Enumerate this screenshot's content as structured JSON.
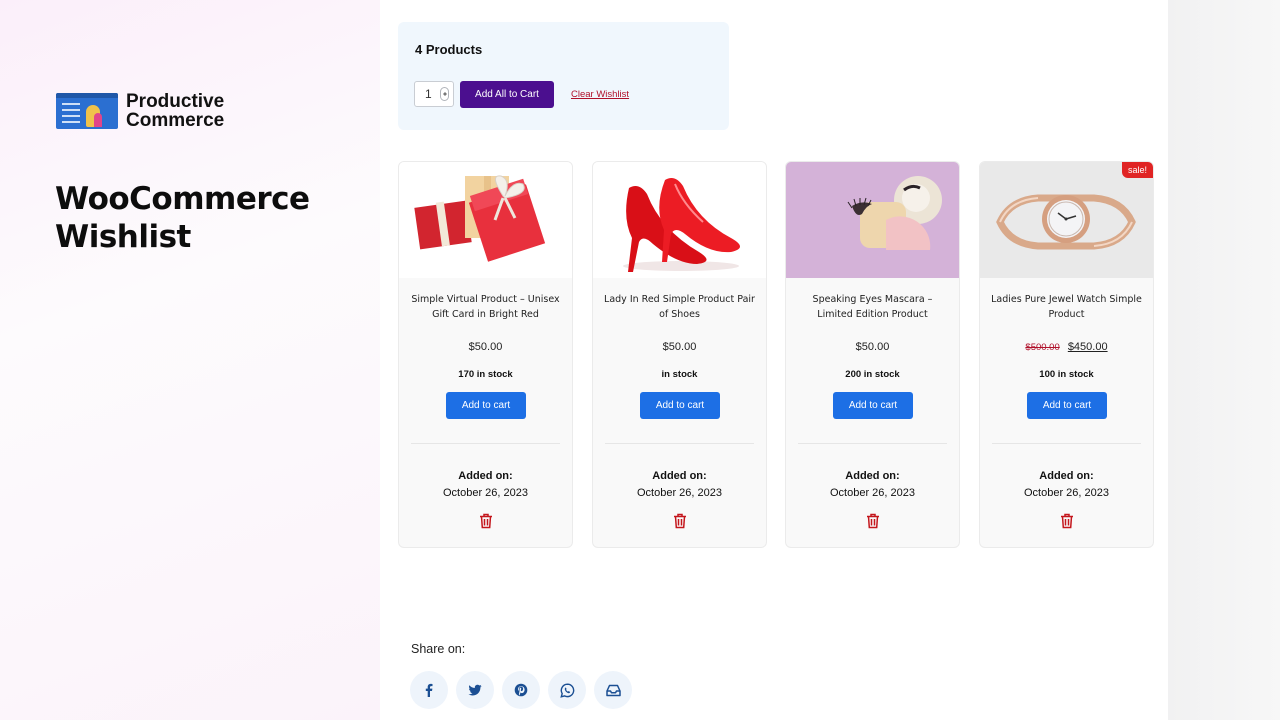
{
  "promo": {
    "brand_line1": "Productive",
    "brand_line2": "Commerce",
    "title_line1": "WooCommerce",
    "title_line2": "Wishlist"
  },
  "wishlist": {
    "count_label": "4 Products",
    "quantity": "1",
    "add_all_label": "Add All to Cart",
    "clear_label": "Clear Wishlist"
  },
  "products": [
    {
      "name": "Simple Virtual Product – Unisex Gift Card in Bright Red",
      "old_price": "",
      "price": "$50.00",
      "stock": "170 in stock",
      "cart_label": "Add to cart",
      "added_label": "Added on:",
      "added_date": "October 26, 2023",
      "image": "gift-box-image"
    },
    {
      "name": "Lady In Red Simple Product Pair of Shoes",
      "old_price": "",
      "price": "$50.00",
      "stock": "in stock",
      "cart_label": "Add to cart",
      "added_label": "Added on:",
      "added_date": "October 26, 2023",
      "image": "red-heels-image"
    },
    {
      "name": "Speaking Eyes Mascara – Limited Edition Product",
      "old_price": "",
      "price": "$50.00",
      "stock": "200 in stock",
      "cart_label": "Add to cart",
      "added_label": "Added on:",
      "added_date": "October 26, 2023",
      "image": "eyelash-image"
    },
    {
      "name": "Ladies Pure Jewel Watch Simple Product",
      "old_price": "$500.00",
      "price": "$450.00",
      "stock": "100 in stock",
      "cart_label": "Add to cart",
      "added_label": "Added on:",
      "added_date": "October 26, 2023",
      "image": "watch-image",
      "badge": "sale!"
    }
  ],
  "share": {
    "label": "Share on:",
    "icons": [
      "facebook-icon",
      "twitter-icon",
      "pinterest-icon",
      "whatsapp-icon",
      "email-icon"
    ]
  },
  "colors": {
    "accent_purple": "#4b0f8f",
    "button_blue": "#1d6fe5",
    "danger_red": "#b0102a",
    "social_blue": "#1b4f93"
  }
}
